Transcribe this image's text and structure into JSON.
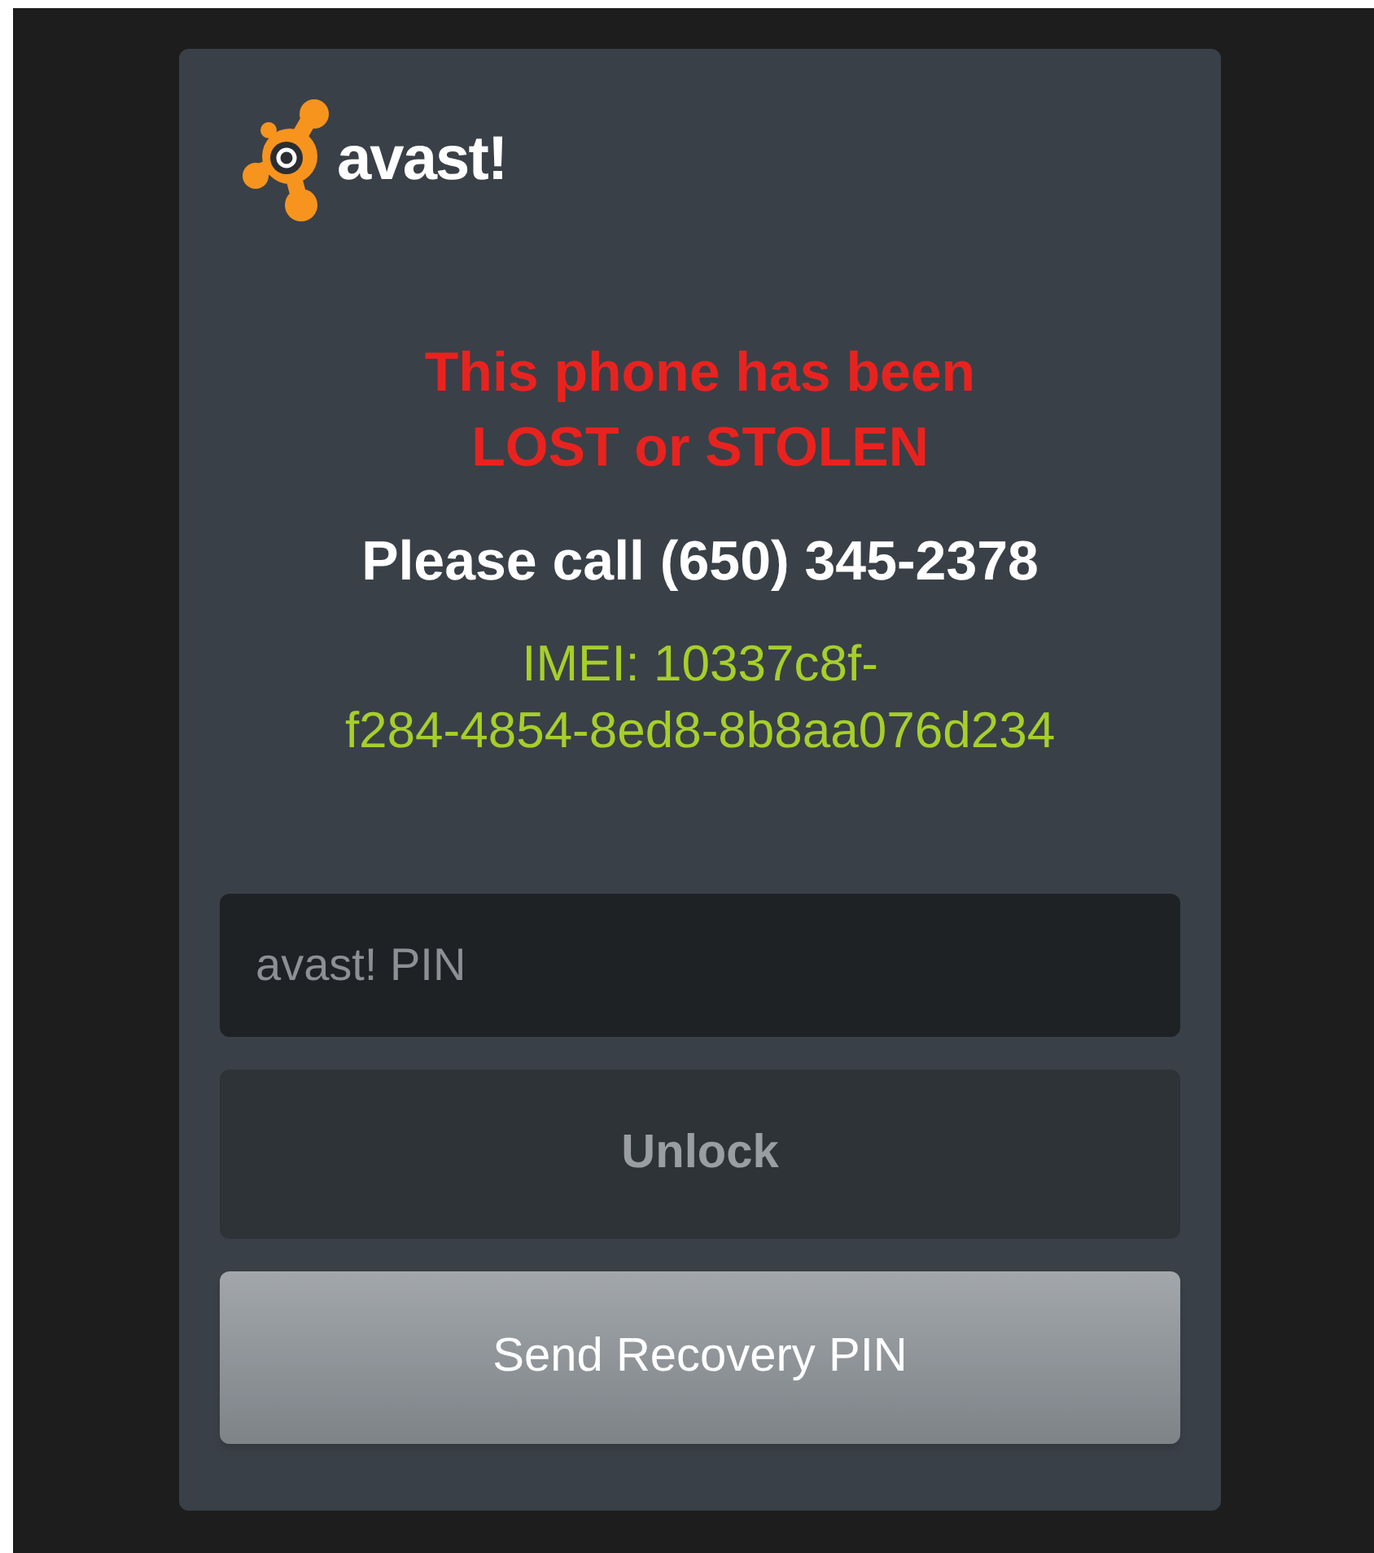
{
  "logo": {
    "text": "avast!"
  },
  "alert_lines": [
    "This phone has been",
    "LOST or STOLEN"
  ],
  "contact": "Please call (650) 345-2378",
  "imei_lines": [
    "IMEI: 10337c8f-",
    "f284-4854-8ed8-8b8aa076d234"
  ],
  "pin_field": {
    "placeholder": "avast! PIN"
  },
  "buttons": [
    {
      "label": "Unlock",
      "kind": "flat",
      "disabled": true
    },
    {
      "label": "Send Recovery PIN",
      "kind": "raised",
      "disabled": false
    }
  ]
}
